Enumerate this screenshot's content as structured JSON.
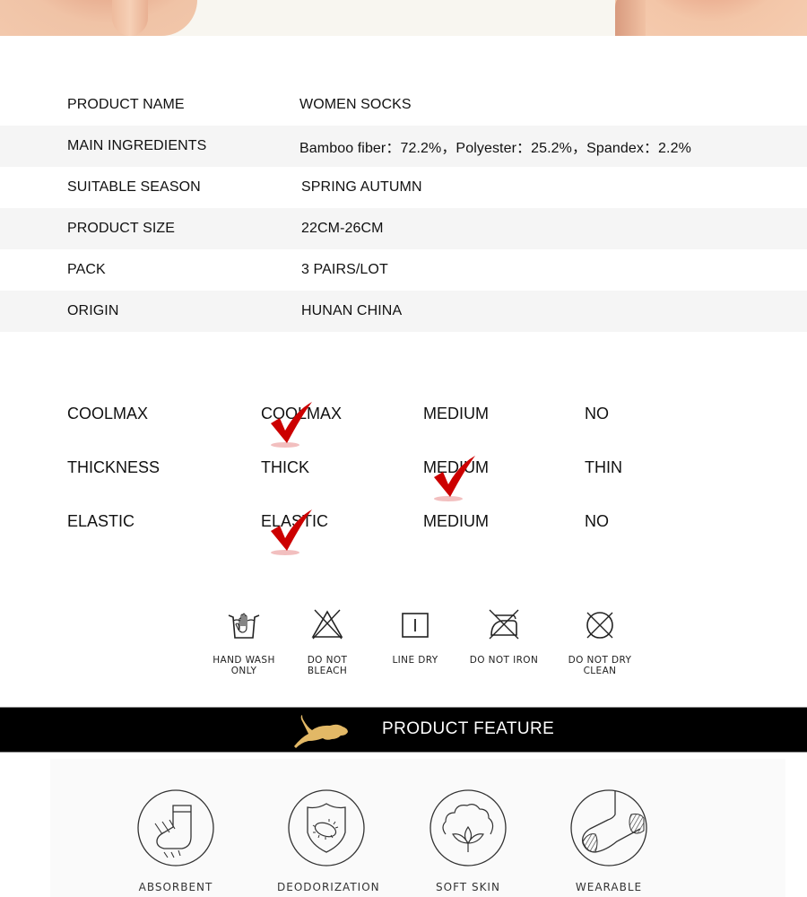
{
  "specs": [
    {
      "label": "PRODUCT NAME",
      "value": "WOMEN  SOCKS"
    },
    {
      "label": "MAIN INGREDIENTS",
      "value": "Bamboo fiber：72.2%，Polyester：25.2%，Spandex：2.2%"
    },
    {
      "label": "SUITABLE SEASON",
      "value": "SPRING  AUTUMN"
    },
    {
      "label": "PRODUCT SIZE",
      "value": "22CM-26CM"
    },
    {
      "label": "PACK",
      "value": "3 PAIRS/LOT"
    },
    {
      "label": "ORIGIN",
      "value": "HUNAN CHINA"
    }
  ],
  "attributes": [
    {
      "name": "COOLMAX",
      "options": [
        "COOLMAX",
        "MEDIUM",
        "NO"
      ],
      "selected": 0
    },
    {
      "name": "THICKNESS",
      "options": [
        "THICK",
        "MEDIUM",
        "THIN"
      ],
      "selected": 1
    },
    {
      "name": "ELASTIC",
      "options": [
        "ELASTIC",
        "MEDIUM",
        "NO"
      ],
      "selected": 0
    }
  ],
  "care": [
    {
      "icon": "hand-wash-icon",
      "label_line1": "HAND WASH",
      "label_line2": "ONLY"
    },
    {
      "icon": "do-not-bleach-icon",
      "label_line1": "DO NOT",
      "label_line2": "BLEACH"
    },
    {
      "icon": "line-dry-icon",
      "label_line1": "LINE DRY",
      "label_line2": ""
    },
    {
      "icon": "do-not-iron-icon",
      "label_line1": "DO NOT IRON",
      "label_line2": ""
    },
    {
      "icon": "do-not-dry-clean-icon",
      "label_line1": "DO NOT DRY",
      "label_line2": "CLEAN"
    }
  ],
  "feature_bar": {
    "title": "PRODUCT FEATURE",
    "icon": "lion-logo-icon",
    "accent": "#e2b866"
  },
  "features": [
    {
      "icon": "absorbent-sock-icon",
      "label": "ABSORBENT"
    },
    {
      "icon": "deodorization-shield-icon",
      "label": "DEODORIZATION"
    },
    {
      "icon": "cotton-flower-icon",
      "label": "SOFT SKIN"
    },
    {
      "icon": "wearable-sock-icon",
      "label": "WEARABLE"
    }
  ],
  "colors": {
    "check": "#cc0000",
    "row_alt": "#f5f5f5",
    "bar": "#000000"
  }
}
